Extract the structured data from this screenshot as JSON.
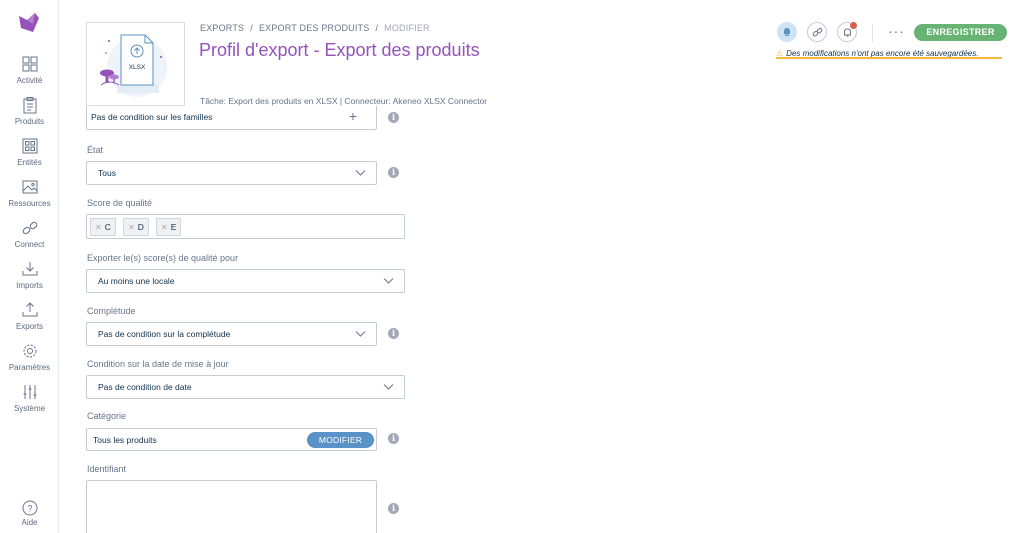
{
  "nav": {
    "items": [
      {
        "label": "Activité",
        "icon": "dashboard-icon"
      },
      {
        "label": "Produits",
        "icon": "clipboard-icon"
      },
      {
        "label": "Entités",
        "icon": "entities-icon"
      },
      {
        "label": "Ressources",
        "icon": "image-icon"
      },
      {
        "label": "Connect",
        "icon": "link-icon"
      },
      {
        "label": "Imports",
        "icon": "import-icon"
      },
      {
        "label": "Exports",
        "icon": "export-icon"
      },
      {
        "label": "Paramètres",
        "icon": "gear-icon"
      },
      {
        "label": "Système",
        "icon": "sliders-icon"
      }
    ],
    "help_label": "Aide"
  },
  "header": {
    "breadcrumb": [
      "EXPORTS",
      "EXPORT DES PRODUITS",
      "MODIFIER"
    ],
    "title": "Profil d'export - Export des produits",
    "task_line": "Tâche: Export des produits en XLSX | Connecteur: Akeneo XLSX Connector",
    "file_badge": "XLSX",
    "more_label": "···",
    "save_label": "ENREGISTRER",
    "unsaved_text": "Des modifications n'ont pas encore été sauvegardées.",
    "warn_glyph": "⚠"
  },
  "form": {
    "family": {
      "value": "Pas de condition sur les familles"
    },
    "state": {
      "label": "État",
      "value": "Tous"
    },
    "quality": {
      "label": "Score de qualité",
      "tags": [
        "C",
        "D",
        "E"
      ]
    },
    "quality_export": {
      "label": "Exporter le(s) score(s) de qualité pour",
      "value": "Au moins une locale"
    },
    "completeness": {
      "label": "Complétude",
      "value": "Pas de condition sur la complétude"
    },
    "update_date": {
      "label": "Condition sur la date de mise à jour",
      "value": "Pas de condition de date"
    },
    "category": {
      "label": "Catégorie",
      "value": "Tous les produits",
      "button": "MODIFIER"
    },
    "identifier": {
      "label": "Identifiant"
    }
  },
  "colors": {
    "accent": "#9452ba",
    "save": "#67b373",
    "button_blue": "#5992c7",
    "warning": "#f9b53f"
  }
}
